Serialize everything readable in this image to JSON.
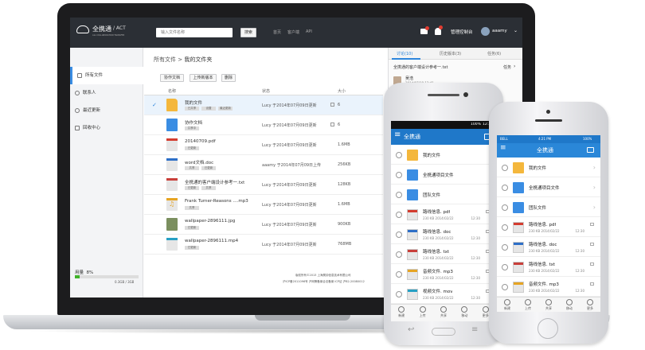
{
  "colors": {
    "accent": "#2e86dc",
    "topbar": "#2b2f35",
    "android_bar": "#1f78c9",
    "ios_bar": "#2a87d8",
    "folder": "#f4b73c",
    "storage": "#41b32b"
  },
  "laptop": {
    "logo_text": "全携通",
    "logo_sub": "/ ACT",
    "logo_tag": "ALL COLLABORATION TRANSFER",
    "search_placeholder": "输入文件名称",
    "search_button": "搜索",
    "top_links": [
      "首页",
      "客户端",
      "API"
    ],
    "console_label": "管理控制台",
    "user_name": "aaamy",
    "sidebar": [
      {
        "label": "所有文件",
        "icon": "file-icon"
      },
      {
        "label": "联系人",
        "icon": "contacts-icon"
      },
      {
        "label": "最近更新",
        "icon": "clock-icon"
      },
      {
        "label": "回收中心",
        "icon": "trash-icon"
      }
    ],
    "storage": {
      "label": "用量",
      "percent_text": "8%",
      "used_text": "0.3GB / 3GB",
      "percent": 0.08
    },
    "breadcrumb": {
      "root": "所有文件",
      "sep": ">",
      "current": "我的文件夹"
    },
    "toolbar": [
      "协作文档",
      "上传新版本",
      "删除"
    ],
    "columns": {
      "name": "名称",
      "status": "状态",
      "size": "大小"
    },
    "files": [
      {
        "name": "我的文件",
        "icon": "folder",
        "tags": [
          "已共享",
          "设置",
          "最近更新"
        ],
        "modified": "Lucy 于2014年07月09日更新",
        "size": "6",
        "comment_icon": true,
        "selected": true
      },
      {
        "name": "协作文档",
        "icon": "team",
        "tags": [
          "共享中"
        ],
        "modified": "Lucy 于2014年07月09日更新",
        "size": "6",
        "comment_icon": true,
        "selected": false
      },
      {
        "name": "20140709.pdf",
        "icon": "pdf",
        "tags": [
          "已更新"
        ],
        "modified": "Lucy 于2014年07月09日更新",
        "size": "1.6MB",
        "selected": false
      },
      {
        "name": "word文档.doc",
        "icon": "doc",
        "tags": [
          "共享",
          "已更新"
        ],
        "modified": "aaamy 于2014年07月09日上传",
        "size": "256KB",
        "selected": false
      },
      {
        "name": "全携通的客户端设计参考一.txt",
        "icon": "txt",
        "tags": [
          "已更新",
          "共享"
        ],
        "modified": "Lucy 于2014年07月09日更新",
        "size": "128KB",
        "selected": false
      },
      {
        "name": "Frank Turner-Reasons ....mp3",
        "icon": "music",
        "tags": [
          "共享"
        ],
        "modified": "Lucy 于2014年07月09日更新",
        "size": "1.6MB",
        "selected": false
      },
      {
        "name": "wallpaper-2896111.jpg",
        "icon": "img",
        "tags": [
          "已更新"
        ],
        "modified": "Lucy 于2014年07月09日更新",
        "size": "900KB",
        "selected": false
      },
      {
        "name": "wallpaper-2896111.mp4",
        "icon": "video",
        "tags": [
          "已更新"
        ],
        "modified": "Lucy 于2014年07月09日更新",
        "size": "768MB",
        "selected": false
      }
    ],
    "footer": {
      "line1": "版权所有©2013 上海昊钟信息技术有限公司",
      "line2": "沪ICP备2011096号  沪网警备案合法备案 ICP证 沪B2-20080012"
    },
    "right_tabs": [
      {
        "label": "讨论(10)",
        "active": true
      },
      {
        "label": "历史版本(3)",
        "active": false
      },
      {
        "label": "任务(6)",
        "active": false
      }
    ],
    "discussion": {
      "title": "全携通的客户端设计参考一.txt",
      "link": "任务",
      "author": "吴浩",
      "date": "2014/07/18 12:41",
      "body": "我总体觉得客户端设计的好，我觉得如果 logo 和 产品 logo 都以 后面的设计，在整体上可以满足。 他们的说出来的图片我们这边的地方的设计进一步的可能和将这个的设计加以完善的设计。",
      "body_lines": [
        "@吴浩",
        "这是企业建立公司 logo 与 产品 logo 到以",
        "前设计问题，和设计方。"
      ]
    }
  },
  "android": {
    "status_text": "100%",
    "time": "12:30",
    "title": "全携通",
    "items": [
      {
        "name": "我的文件",
        "icon": "folder",
        "meta": "",
        "time": ""
      },
      {
        "name": "全携通项目文件",
        "icon": "team",
        "meta": "",
        "time": ""
      },
      {
        "name": "团队文件",
        "icon": "team",
        "meta": "",
        "time": ""
      },
      {
        "name": "路线信息. pdf",
        "icon": "pdf",
        "meta": "230 KB  2014/02/22",
        "time": "12:30"
      },
      {
        "name": "路线信息. doc",
        "icon": "doc",
        "meta": "230 KB  2014/02/22",
        "time": "12:30"
      },
      {
        "name": "路线信息. txt",
        "icon": "txt",
        "meta": "230 KB  2014/02/22",
        "time": "12:30"
      },
      {
        "name": "音频文件. mp3",
        "icon": "music",
        "meta": "230 KB  2014/02/22",
        "time": "12:30"
      },
      {
        "name": "视频文件. mov",
        "icon": "video",
        "meta": "230 KB  2014/02/22",
        "time": "12:30"
      }
    ],
    "tabbar": [
      "新建",
      "上传",
      "共享",
      "移动",
      "更多"
    ]
  },
  "iphone": {
    "carrier": "BELL",
    "time": "4:21 PM",
    "battery": "100%",
    "title": "全携通",
    "items": [
      {
        "name": "我的文件",
        "icon": "folder",
        "meta": "",
        "time": ""
      },
      {
        "name": "全携通项目文件",
        "icon": "team",
        "meta": "",
        "time": ""
      },
      {
        "name": "团队文件",
        "icon": "team",
        "meta": "",
        "time": ""
      },
      {
        "name": "路线信息. pdf",
        "icon": "pdf",
        "meta": "230 KB  2014/02/22",
        "time": "12:30"
      },
      {
        "name": "路线信息. doc",
        "icon": "doc",
        "meta": "230 KB  2014/02/22",
        "time": "12:30"
      },
      {
        "name": "路线信息. txt",
        "icon": "txt",
        "meta": "230 KB  2014/02/22",
        "time": "12:30"
      },
      {
        "name": "音频文件. mp3",
        "icon": "music",
        "meta": "230 KB  2014/02/22",
        "time": "12:30"
      }
    ],
    "tabbar": [
      "新建",
      "上传",
      "共享",
      "移动",
      "更多"
    ]
  }
}
